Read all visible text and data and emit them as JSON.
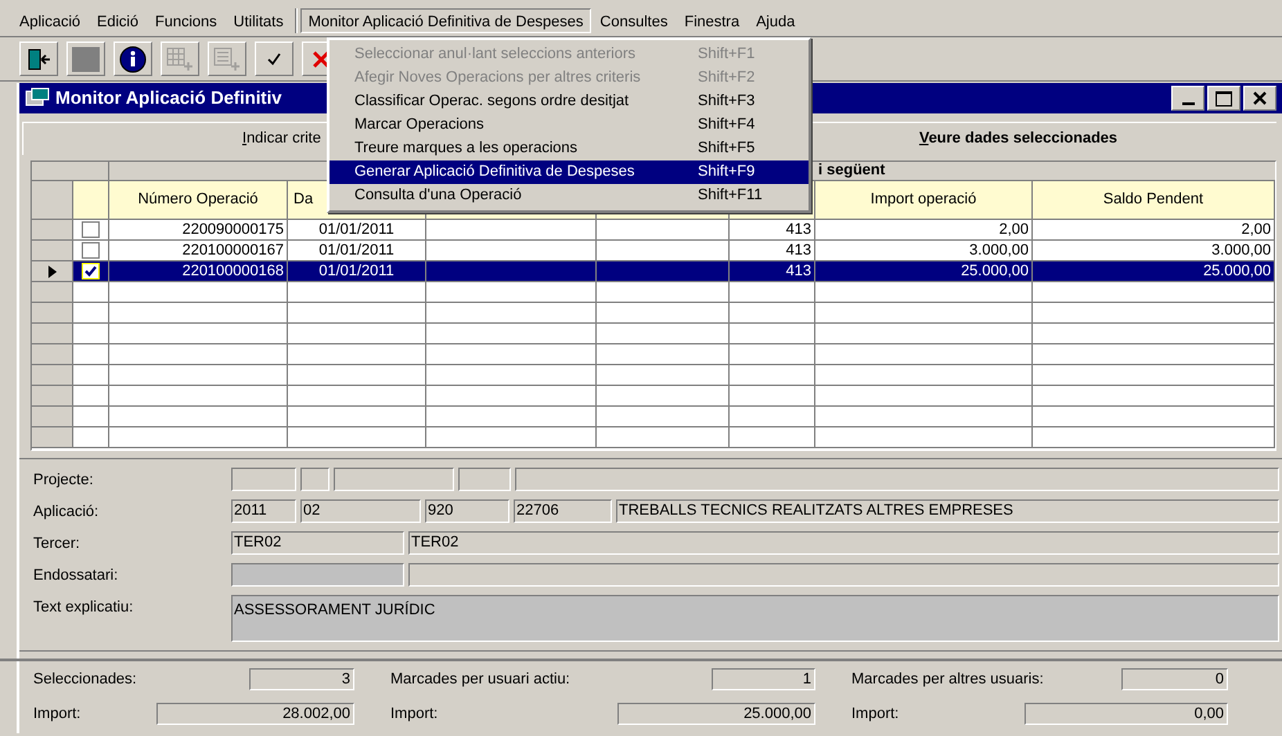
{
  "menu_bar": {
    "items": [
      {
        "label": "Aplicació",
        "selected": false
      },
      {
        "label": "Edició",
        "selected": false
      },
      {
        "label": "Funcions",
        "selected": false
      },
      {
        "label": "Utilitats",
        "selected": false
      },
      {
        "label": "Monitor Aplicació Definitiva de Despeses",
        "selected": true
      },
      {
        "label": "Consultes",
        "selected": false
      },
      {
        "label": "Finestra",
        "selected": false
      },
      {
        "label": "Ajuda",
        "selected": false
      }
    ]
  },
  "toolbar": {
    "buttons": [
      {
        "kind": "exit",
        "disabled": false
      },
      {
        "kind": "blank",
        "disabled": false
      },
      {
        "kind": "info",
        "disabled": false
      },
      {
        "kind": "add-grid",
        "disabled": true
      },
      {
        "kind": "add-list",
        "disabled": true
      },
      {
        "kind": "check",
        "disabled": false
      },
      {
        "kind": "cancel",
        "disabled": false
      }
    ]
  },
  "dropdown": {
    "items": [
      {
        "label": "Seleccionar anul·lant seleccions anteriors",
        "shortcut": "Shift+F1",
        "disabled": true,
        "selected": false
      },
      {
        "label": "Afegir Noves Operacions per altres criteris",
        "shortcut": "Shift+F2",
        "disabled": true,
        "selected": false
      },
      {
        "label": "Classificar Operac. segons ordre desitjat",
        "shortcut": "Shift+F3",
        "disabled": false,
        "selected": false
      },
      {
        "label": "Marcar Operacions",
        "shortcut": "Shift+F4",
        "disabled": false,
        "selected": false
      },
      {
        "label": "Treure marques a les operacions",
        "shortcut": "Shift+F5",
        "disabled": false,
        "selected": false
      },
      {
        "label": "Generar Aplicació Definitiva de Despeses",
        "shortcut": "Shift+F9",
        "disabled": false,
        "selected": true
      },
      {
        "label": "Consulta d'una Operació",
        "shortcut": "Shift+F11",
        "disabled": false,
        "selected": false
      }
    ]
  },
  "window": {
    "title": "Monitor Aplicació Definitiv"
  },
  "tabs": [
    {
      "label": "Indicar crite",
      "selected": false
    },
    {
      "label": "Veure dades seleccionades",
      "selected": true
    }
  ],
  "grid": {
    "group_header": "i següent",
    "columns": [
      "Número Operació",
      "Da",
      "Import operació",
      "Saldo Pendent"
    ],
    "rows": [
      {
        "checked": false,
        "current": false,
        "selected": false,
        "cells": [
          "220090000175",
          "01/01/2011",
          "413",
          "2,00",
          "2,00"
        ]
      },
      {
        "checked": false,
        "current": false,
        "selected": false,
        "cells": [
          "220100000167",
          "01/01/2011",
          "413",
          "3.000,00",
          "3.000,00"
        ]
      },
      {
        "checked": true,
        "current": true,
        "selected": true,
        "cells": [
          "220100000168",
          "01/01/2011",
          "413",
          "25.000,00",
          "25.000,00"
        ]
      }
    ]
  },
  "details": [
    {
      "label": "Projecte:",
      "fields": [
        {
          "disabled": false
        },
        {
          "disabled": false
        },
        {
          "disabled": false
        },
        {
          "disabled": false
        },
        {
          "disabled": false
        }
      ]
    },
    {
      "label": "Aplicació:",
      "fields": [
        {
          "value": "2011",
          "disabled": false
        },
        {
          "value": "02",
          "disabled": false
        },
        {
          "value": "920",
          "disabled": false
        },
        {
          "value": "22706",
          "disabled": false
        },
        {
          "value": "TREBALLS TECNICS REALITZATS ALTRES EMPRESES",
          "disabled": false
        }
      ]
    },
    {
      "label": "Tercer:",
      "fields": [
        {
          "value": "TER02",
          "disabled": false
        },
        {
          "value": "TER02",
          "disabled": false
        }
      ]
    },
    {
      "label": "Endossatari:",
      "fields": [
        {
          "disabled": true
        },
        {
          "disabled": false
        }
      ]
    },
    {
      "label": "Text explicatiu:",
      "fields": [
        {
          "value": "ASSESSORAMENT JURÍDIC",
          "disabled": true
        }
      ]
    }
  ],
  "summary": [
    {
      "label": "Seleccionades:",
      "count": "3",
      "import_label": "Import:",
      "import": "28.002,00"
    },
    {
      "label": "Marcades per usuari actiu:",
      "count": "1",
      "import_label": "Import:",
      "import": "25.000,00"
    },
    {
      "label": "Marcades per altres usuaris:",
      "count": "0",
      "import_label": "Import:",
      "import": "0,00"
    }
  ]
}
